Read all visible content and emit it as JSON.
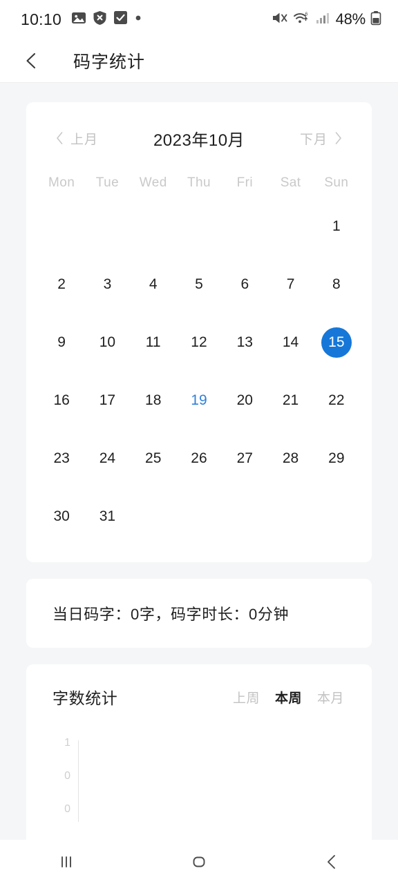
{
  "status_bar": {
    "clock": "10:10",
    "battery_text": "48%",
    "left_icons": [
      "photo-icon",
      "shield-x-icon",
      "checkbox-checked-icon",
      "dot-icon"
    ],
    "right_icons": [
      "mute-icon",
      "wifi-icon",
      "signal-icon",
      "battery-icon"
    ]
  },
  "app_bar": {
    "back_label": "back",
    "title": "码字统计"
  },
  "calendar": {
    "prev_month_label": "上月",
    "next_month_label": "下月",
    "current_month": "2023年10月",
    "weekdays": [
      "Mon",
      "Tue",
      "Wed",
      "Thu",
      "Fri",
      "Sat",
      "Sun"
    ],
    "leading_blanks": 6,
    "days": [
      1,
      2,
      3,
      4,
      5,
      6,
      7,
      8,
      9,
      10,
      11,
      12,
      13,
      14,
      15,
      16,
      17,
      18,
      19,
      20,
      21,
      22,
      23,
      24,
      25,
      26,
      27,
      28,
      29,
      30,
      31
    ],
    "today": 15,
    "marked_days": [
      19
    ],
    "today_color": "#1677d8",
    "marked_color": "#2f80d8"
  },
  "daily_stat": {
    "text": "当日码字：0字，码字时长：0分钟"
  },
  "chart_card": {
    "title": "字数统计",
    "tabs": [
      {
        "label": "上周",
        "active": false
      },
      {
        "label": "本周",
        "active": true
      },
      {
        "label": "本月",
        "active": false
      }
    ]
  },
  "chart_data": {
    "type": "bar",
    "title": "字数统计",
    "categories": [],
    "values": [],
    "series": [
      {
        "name": "本周",
        "values": []
      }
    ],
    "ytick_labels": [
      "1",
      "0",
      "0"
    ],
    "ylim": [
      0,
      1
    ],
    "xlabel": "",
    "ylabel": "",
    "grid": false,
    "legend": "none",
    "note": "chart plot area is empty / clipped by viewport bottom"
  },
  "nav_bar": {
    "recents_label": "recents",
    "home_label": "home",
    "back_label": "back"
  }
}
